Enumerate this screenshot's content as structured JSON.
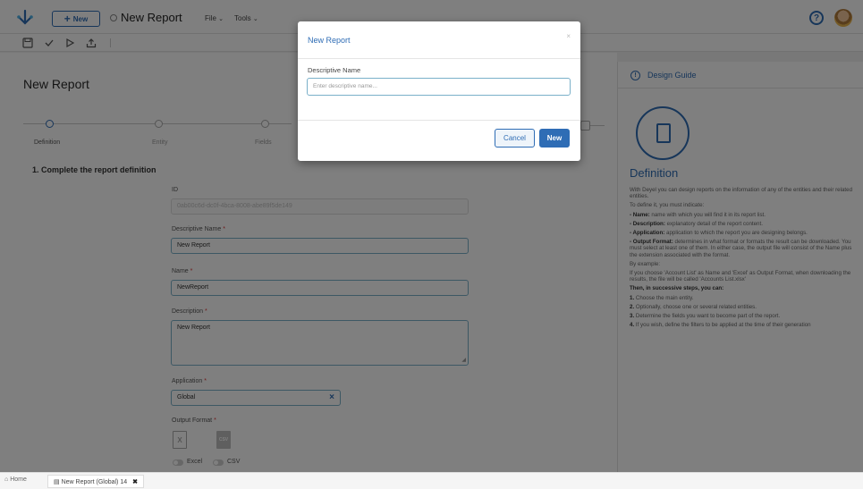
{
  "topbar": {
    "new_label": "New",
    "title": "New Report",
    "menus": [
      "File",
      "Tools"
    ],
    "help_glyph": "?"
  },
  "toolbar": {
    "icons": [
      "save-icon",
      "check-icon",
      "play-icon",
      "export-icon"
    ]
  },
  "main": {
    "title": "New Report",
    "steps": [
      "Definition",
      "Entity",
      "Fields"
    ],
    "section_title": "1. Complete the report definition",
    "fields": {
      "id_label": "ID",
      "id_value": "0ab00c6d-dc0f-4bca-8008-abe89f5de149",
      "descriptive_name_label": "Descriptive Name",
      "descriptive_name_value": "New Report",
      "name_label": "Name",
      "name_value": "NewReport",
      "description_label": "Description",
      "description_value": "New Report",
      "application_label": "Application",
      "application_value": "Global",
      "output_format_label": "Output Format",
      "excel_label": "Excel",
      "csv_label": "CSV",
      "excel_icon_text": "X",
      "csv_icon_text": "CSV"
    },
    "required_mark": "*"
  },
  "guide": {
    "header": "Design Guide",
    "title": "Definition",
    "p1": "With Deyel you can design reports on the information of any of the entities and their related entities.",
    "p2": "To define it, you must indicate:",
    "name_b": "- Name:",
    "name_t": " name with which you will find it in its report list.",
    "desc_b": "- Description:",
    "desc_t": " explanatory detail of the report content.",
    "app_b": "- Application:",
    "app_t": " application to which the report you are designing belongs.",
    "out_b": "- Output Format:",
    "out_t": " determines in what format or formats the result can be downloaded. You must select at least one of them. In either case, the output file will consist of the Name plus the extension associated with the format.",
    "p_example": "By example:",
    "p_example_text": "If you choose 'Account List' as Name and 'Excel' as Output Format, when downloading the results, the file will be called 'Accounts List.xlsx'",
    "steps_title": "Then, in successive steps, you can:",
    "s1_b": "1.",
    "s1_t": " Choose the main entity.",
    "s2_b": "2.",
    "s2_t": " Optionally, choose one or several related entities.",
    "s3_b": "3.",
    "s3_t": " Determine the fields you want to become part of the report.",
    "s4_b": "4.",
    "s4_t": " If you wish, define the filters to be applied at the time of their generation"
  },
  "modal": {
    "title": "New Report",
    "close": "×",
    "label": "Descriptive Name",
    "placeholder": "Enter descriptive name...",
    "cancel": "Cancel",
    "ok": "New"
  },
  "bottom": {
    "home": "Home",
    "tab": "New Report (Global) 14",
    "tab_close": "✖"
  },
  "colors": {
    "accent": "#2f6db5",
    "overlay": "rgba(0,0,0,0.5)"
  }
}
